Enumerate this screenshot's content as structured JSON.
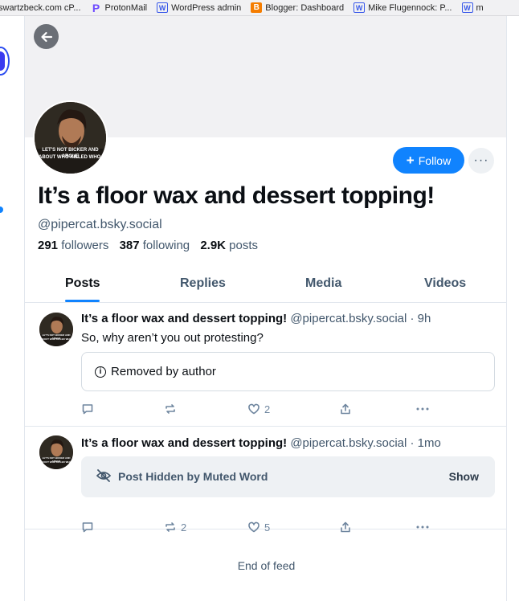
{
  "bookmarks": [
    {
      "label": "swartzbeck.com cP...",
      "icon": "cpanel-icon"
    },
    {
      "label": "ProtonMail",
      "icon": "protonmail-icon"
    },
    {
      "label": "WordPress admin",
      "icon": "wordpress-icon"
    },
    {
      "label": "Blogger: Dashboard",
      "icon": "blogger-icon"
    },
    {
      "label": "Mike Flugennock: P...",
      "icon": "wordpress-icon"
    },
    {
      "label": "m",
      "icon": "wordpress-icon"
    }
  ],
  "profile": {
    "avatar_caption_1": "LET'S NOT BICKER AND ARGUE",
    "avatar_caption_2": "ABOUT WHO KILLED WHO.",
    "display_name": "It’s a floor wax and dessert topping!",
    "handle": "@pipercat.bsky.social",
    "followers_count": "291",
    "followers_label": "followers",
    "following_count": "387",
    "following_label": "following",
    "posts_count": "2.9K",
    "posts_label": "posts",
    "follow_label": "Follow",
    "more_label": "···"
  },
  "tabs": [
    "Posts",
    "Replies",
    "Media",
    "Videos"
  ],
  "active_tab": "Posts",
  "posts": [
    {
      "author": "It’s a floor wax and dessert topping!",
      "meta": "@pipercat.bsky.social · 9h",
      "text": "So, why aren’t you out protesting?",
      "embed_text": "Removed by author",
      "reply_count": "",
      "repost_count": "",
      "like_count": "2"
    },
    {
      "author": "It’s a floor wax and dessert topping!",
      "meta": "@pipercat.bsky.social · 1mo",
      "hidden_label": "Post Hidden by Muted Word",
      "show_label": "Show",
      "reply_count": "",
      "repost_count": "2",
      "like_count": "5"
    }
  ],
  "end_of_feed": "End of feed",
  "colors": {
    "accent": "#1083fe",
    "muted_text": "#42576c",
    "action_icon": "#6f869f",
    "banner": "#f1f1f3"
  }
}
